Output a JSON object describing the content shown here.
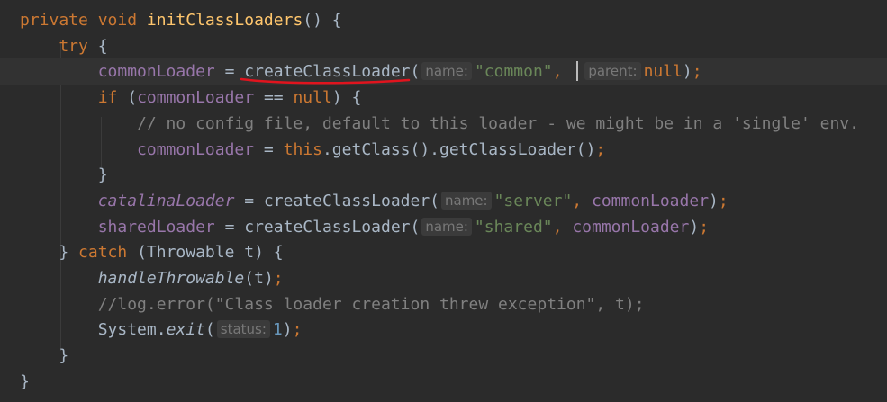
{
  "editor": {
    "language": "java",
    "lines": [
      {
        "tokens": [
          {
            "t": "private ",
            "c": "kw"
          },
          {
            "t": "void ",
            "c": "kw"
          },
          {
            "t": "initClassLoaders",
            "c": "fn"
          },
          {
            "t": "() {",
            "c": "plain"
          }
        ]
      },
      {
        "tokens": [
          {
            "t": "    try ",
            "c": "kw"
          },
          {
            "t": "{",
            "c": "plain"
          }
        ]
      },
      {
        "current": true,
        "tokens": [
          {
            "t": "        ",
            "c": "plain"
          },
          {
            "t": "commonLoader",
            "c": "field"
          },
          {
            "t": " = ",
            "c": "plain"
          },
          {
            "t": "createClassLoader",
            "c": "plain"
          },
          {
            "t": "(",
            "c": "plain"
          },
          {
            "hint": "name:"
          },
          {
            "t": "\"common\"",
            "c": "str"
          },
          {
            "t": ", ",
            "c": "kw"
          },
          {
            "caret": true
          },
          {
            "hint": "parent:"
          },
          {
            "t": "null",
            "c": "kw"
          },
          {
            "t": ")",
            "c": "plain"
          },
          {
            "t": ";",
            "c": "kw"
          }
        ]
      },
      {
        "tokens": [
          {
            "t": "        if ",
            "c": "kw"
          },
          {
            "t": "(",
            "c": "plain"
          },
          {
            "t": "commonLoader",
            "c": "field"
          },
          {
            "t": " == ",
            "c": "plain"
          },
          {
            "t": "null",
            "c": "kw"
          },
          {
            "t": ") {",
            "c": "plain"
          }
        ]
      },
      {
        "tokens": [
          {
            "t": "            // no config file, default to this loader - we might be in a 'single' env.",
            "c": "cmt"
          }
        ]
      },
      {
        "tokens": [
          {
            "t": "            ",
            "c": "plain"
          },
          {
            "t": "commonLoader",
            "c": "field"
          },
          {
            "t": " = ",
            "c": "plain"
          },
          {
            "t": "this",
            "c": "kw"
          },
          {
            "t": ".getClass().getClassLoader()",
            "c": "plain"
          },
          {
            "t": ";",
            "c": "kw"
          }
        ]
      },
      {
        "tokens": [
          {
            "t": "        }",
            "c": "plain"
          }
        ]
      },
      {
        "tokens": [
          {
            "t": "        ",
            "c": "plain"
          },
          {
            "t": "catalinaLoader",
            "c": "field ital"
          },
          {
            "t": " = createClassLoader(",
            "c": "plain"
          },
          {
            "hint": "name:"
          },
          {
            "t": "\"server\"",
            "c": "str"
          },
          {
            "t": ", ",
            "c": "kw"
          },
          {
            "t": "commonLoader",
            "c": "field"
          },
          {
            "t": ")",
            "c": "plain"
          },
          {
            "t": ";",
            "c": "kw"
          }
        ]
      },
      {
        "tokens": [
          {
            "t": "        ",
            "c": "plain"
          },
          {
            "t": "sharedLoader",
            "c": "field"
          },
          {
            "t": " = createClassLoader(",
            "c": "plain"
          },
          {
            "hint": "name:"
          },
          {
            "t": "\"shared\"",
            "c": "str"
          },
          {
            "t": ", ",
            "c": "kw"
          },
          {
            "t": "commonLoader",
            "c": "field"
          },
          {
            "t": ")",
            "c": "plain"
          },
          {
            "t": ";",
            "c": "kw"
          }
        ]
      },
      {
        "tokens": [
          {
            "t": "    } ",
            "c": "plain"
          },
          {
            "t": "catch ",
            "c": "kw"
          },
          {
            "t": "(Throwable t) {",
            "c": "plain"
          }
        ]
      },
      {
        "tokens": [
          {
            "t": "        ",
            "c": "plain"
          },
          {
            "t": "handleThrowable",
            "c": "plain ital"
          },
          {
            "t": "(t)",
            "c": "plain"
          },
          {
            "t": ";",
            "c": "kw"
          }
        ]
      },
      {
        "tokens": [
          {
            "t": "        //log.error(\"Class loader creation threw exception\", t);",
            "c": "cmt"
          }
        ]
      },
      {
        "tokens": [
          {
            "t": "        System.",
            "c": "plain"
          },
          {
            "t": "exit",
            "c": "plain ital"
          },
          {
            "t": "(",
            "c": "plain"
          },
          {
            "hint": "status:"
          },
          {
            "t": "1",
            "c": "num"
          },
          {
            "t": ")",
            "c": "plain"
          },
          {
            "t": ";",
            "c": "kw"
          }
        ]
      },
      {
        "tokens": [
          {
            "t": "    }",
            "c": "plain"
          }
        ]
      },
      {
        "tokens": [
          {
            "t": "}",
            "c": "plain"
          }
        ]
      }
    ]
  },
  "colors": {
    "background": "#2b2b2b",
    "keyword": "#cc7832",
    "method_declaration": "#ffc66d",
    "field": "#9876aa",
    "string": "#6a8759",
    "comment": "#808080",
    "number": "#6897bb",
    "text": "#a9b7c6",
    "hint_bg": "#3b3b3b",
    "hint_text": "#787878",
    "annotation_underline": "#e0141e"
  }
}
